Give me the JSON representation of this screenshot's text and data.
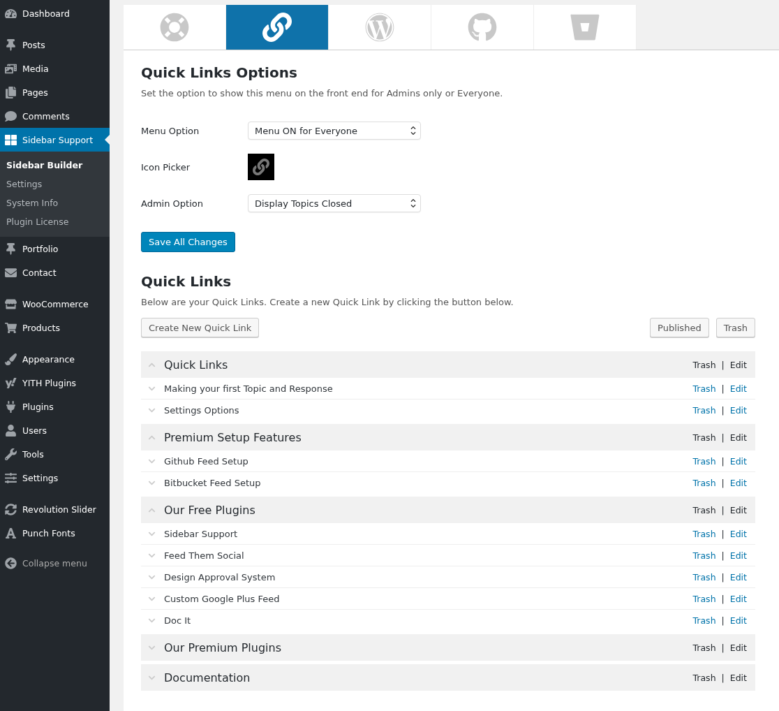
{
  "sidebar": {
    "sections": [
      {
        "items": [
          {
            "label": "Dashboard",
            "selected": false
          }
        ]
      },
      {
        "items": [
          {
            "label": "Posts",
            "selected": false
          },
          {
            "label": "Media",
            "selected": false
          },
          {
            "label": "Pages",
            "selected": false
          },
          {
            "label": "Comments",
            "selected": false
          },
          {
            "label": "Sidebar Support",
            "selected": true,
            "children": [
              {
                "label": "Sidebar Builder",
                "selected": true
              },
              {
                "label": "Settings",
                "selected": false
              },
              {
                "label": "System Info",
                "selected": false
              },
              {
                "label": "Plugin License",
                "selected": false
              }
            ]
          },
          {
            "label": "Portfolio",
            "selected": false
          },
          {
            "label": "Contact",
            "selected": false
          }
        ]
      },
      {
        "items": [
          {
            "label": "WooCommerce",
            "selected": false
          },
          {
            "label": "Products",
            "selected": false
          }
        ]
      },
      {
        "items": [
          {
            "label": "Appearance",
            "selected": false
          },
          {
            "label": "YITH Plugins",
            "selected": false
          },
          {
            "label": "Plugins",
            "selected": false
          },
          {
            "label": "Users",
            "selected": false
          },
          {
            "label": "Tools",
            "selected": false
          },
          {
            "label": "Settings",
            "selected": false
          }
        ]
      },
      {
        "items": [
          {
            "label": "Revolution Slider",
            "selected": false
          },
          {
            "label": "Punch Fonts",
            "selected": false
          }
        ]
      }
    ],
    "collapse": "Collapse menu"
  },
  "tabs": [
    {
      "kind": "lifebuoy",
      "selected": false
    },
    {
      "kind": "link",
      "selected": true
    },
    {
      "kind": "wordpress",
      "selected": false
    },
    {
      "kind": "github",
      "selected": false
    },
    {
      "kind": "bucket",
      "selected": false
    }
  ],
  "options": {
    "title": "Quick Links Options",
    "description": "Set the option to show this menu on the front end for Admins only or Everyone.",
    "fields": [
      {
        "kind": "select",
        "label": "Menu Option",
        "value": "Menu ON for Everyone"
      },
      {
        "kind": "icon",
        "label": "Icon Picker"
      },
      {
        "kind": "select",
        "label": "Admin Option",
        "value": "Display Topics Closed"
      }
    ],
    "save": "Save All Changes"
  },
  "quick_links": {
    "title": "Quick Links",
    "description": "Below are your Quick Links. Create a new Quick Link by clicking the button below.",
    "create": "Create New Quick Link",
    "filters": [
      "Published",
      "Trash"
    ],
    "groups": [
      {
        "title": "Quick Links",
        "expanded": true,
        "trash": "Trash",
        "sep": "|",
        "edit": "Edit",
        "items": [
          {
            "title": "Making your first Topic and Response",
            "trash": "Trash",
            "sep": "|",
            "edit": "Edit"
          },
          {
            "title": "Settings Options",
            "trash": "Trash",
            "sep": "|",
            "edit": "Edit"
          }
        ]
      },
      {
        "title": "Premium Setup Features",
        "expanded": true,
        "trash": "Trash",
        "sep": "|",
        "edit": "Edit",
        "items": [
          {
            "title": "Github Feed Setup",
            "trash": "Trash",
            "sep": "|",
            "edit": "Edit"
          },
          {
            "title": "Bitbucket Feed Setup",
            "trash": "Trash",
            "sep": "|",
            "edit": "Edit"
          }
        ]
      },
      {
        "title": "Our Free Plugins",
        "expanded": true,
        "trash": "Trash",
        "sep": "|",
        "edit": "Edit",
        "items": [
          {
            "title": "Sidebar Support",
            "trash": "Trash",
            "sep": "|",
            "edit": "Edit"
          },
          {
            "title": "Feed Them Social",
            "trash": "Trash",
            "sep": "|",
            "edit": "Edit"
          },
          {
            "title": "Design Approval System",
            "trash": "Trash",
            "sep": "|",
            "edit": "Edit"
          },
          {
            "title": "Custom Google Plus Feed",
            "trash": "Trash",
            "sep": "|",
            "edit": "Edit"
          },
          {
            "title": "Doc It",
            "trash": "Trash",
            "sep": "|",
            "edit": "Edit"
          }
        ]
      },
      {
        "title": "Our Premium Plugins",
        "expanded": false,
        "trash": "Trash",
        "sep": "|",
        "edit": "Edit"
      },
      {
        "title": "Documentation",
        "expanded": false,
        "trash": "Trash",
        "sep": "|",
        "edit": "Edit"
      }
    ]
  }
}
